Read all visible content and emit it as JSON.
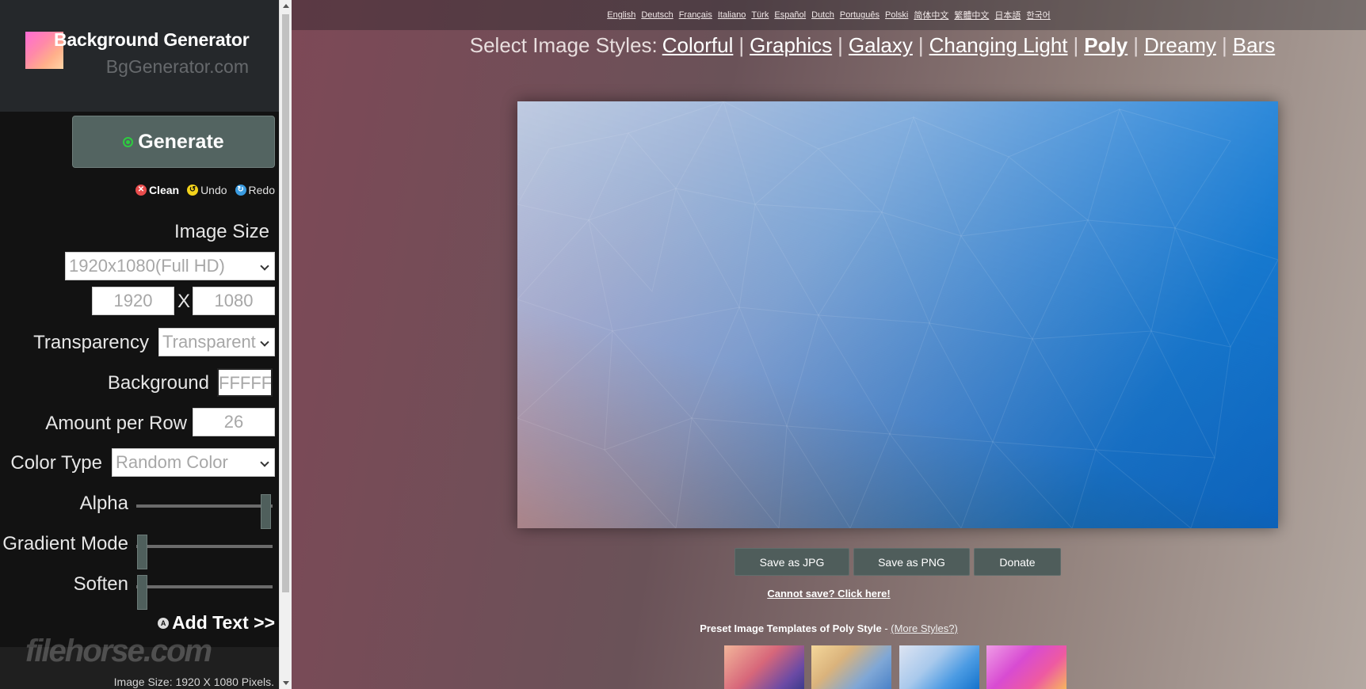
{
  "brand": {
    "title": "Background Generator",
    "subtitle": "BgGenerator.com"
  },
  "sidebar": {
    "generate_label": "Generate",
    "actions": {
      "clean": "Clean",
      "undo": "Undo",
      "redo": "Redo"
    },
    "image_size_label": "Image Size",
    "image_size_select": "1920x1080(Full HD)",
    "width_value": "1920",
    "x_label": "X",
    "height_value": "1080",
    "transparency_label": "Transparency",
    "transparency_select": "Transparent",
    "background_label": "Background",
    "background_value": "FFFFFF",
    "amount_label": "Amount per Row",
    "amount_value": "26",
    "color_type_label": "Color Type",
    "color_type_select": "Random Color",
    "alpha_label": "Alpha",
    "alpha_value": 1.0,
    "gradient_label": "Gradient Mode",
    "gradient_value": 0.0,
    "soften_label": "Soften",
    "soften_value": 0.0,
    "add_text_label": "Add Text >>",
    "watermark": "filehorse.com",
    "image_size_info": "Image Size: 1920 X 1080 Pixels."
  },
  "languages": [
    "English",
    "Deutsch",
    "Français",
    "Italiano",
    "Türk",
    "Español",
    "Dutch",
    "Português",
    "Polski",
    "简体中文",
    "繁體中文",
    "日本語",
    "한국어"
  ],
  "styles": {
    "prefix": "Select Image Styles:",
    "items": [
      {
        "label": "Colorful",
        "active": false
      },
      {
        "label": "Graphics",
        "active": false
      },
      {
        "label": "Galaxy",
        "active": false
      },
      {
        "label": "Changing Light",
        "active": false
      },
      {
        "label": "Poly",
        "active": true
      },
      {
        "label": "Dreamy",
        "active": false
      },
      {
        "label": "Bars",
        "active": false
      }
    ]
  },
  "buttons": {
    "save_jpg": "Save as JPG",
    "save_png": "Save as PNG",
    "donate": "Donate"
  },
  "cannot_save": "Cannot save? Click here!",
  "presets": {
    "title_bold": "Preset Image Templates of Poly Style",
    "title_sep": " - ",
    "more_styles": "(More Styles?)"
  },
  "colors": {
    "sidebar_bg": "#121212",
    "button_bg": "#536461",
    "canvas_top_right": "#0e7fde",
    "canvas_bottom_left": "#f0a090"
  }
}
